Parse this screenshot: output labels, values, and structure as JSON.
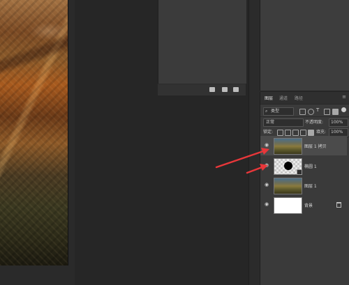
{
  "tabs": [
    "图层",
    "通道",
    "路径"
  ],
  "filter": {
    "kind_label": "类型"
  },
  "blend": {
    "mode": "正常",
    "opacity_label": "不透明度:",
    "opacity_value": "100%"
  },
  "lock": {
    "label": "锁定:",
    "fill_label": "填充:",
    "fill_value": "100%"
  },
  "layers": [
    {
      "name": "图层 1 拷贝",
      "selected": true,
      "thumb": "image"
    },
    {
      "name": "椭圆 1",
      "selected": false,
      "thumb": "ellipse"
    },
    {
      "name": "图层 1",
      "selected": false,
      "thumb": "image"
    },
    {
      "name": "背景",
      "selected": false,
      "thumb": "white",
      "locked": true
    }
  ],
  "colors": {
    "arrow": "#e8373a",
    "panel": "#3a3a3a",
    "selected_row": "#4b4b4b"
  }
}
